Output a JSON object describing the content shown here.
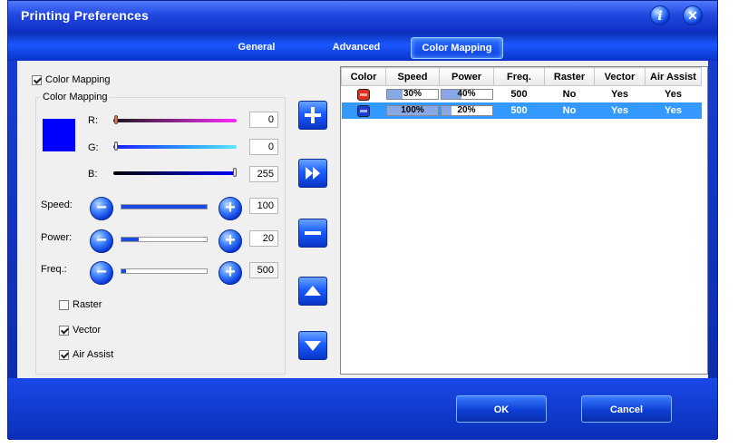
{
  "window": {
    "title": "Printing Preferences"
  },
  "header": {
    "info_icon": "info-icon",
    "close_icon": "close-icon"
  },
  "tabs": [
    {
      "label": "General",
      "active": false
    },
    {
      "label": "Advanced",
      "active": false
    },
    {
      "label": "Color Mapping",
      "active": true
    }
  ],
  "left": {
    "color_mapping_checkbox": {
      "label": "Color Mapping",
      "checked": true
    },
    "group_title": "Color Mapping",
    "swatch_color": "#0000ff",
    "rgb": [
      {
        "label": "R:",
        "value": "0",
        "level": 0
      },
      {
        "label": "G:",
        "value": "0",
        "level": 0
      },
      {
        "label": "B:",
        "value": "255",
        "level": 1
      }
    ],
    "params": [
      {
        "label": "Speed:",
        "value": "100",
        "level": 1.0,
        "readonly": false
      },
      {
        "label": "Power:",
        "value": "20",
        "level": 0.2,
        "readonly": false
      },
      {
        "label": "Freq.:",
        "value": "500",
        "level": 0.05,
        "readonly": true
      }
    ],
    "options": [
      {
        "label": "Raster",
        "checked": false
      },
      {
        "label": "Vector",
        "checked": true
      },
      {
        "label": "Air Assist",
        "checked": true
      }
    ]
  },
  "middle_buttons": [
    "add-icon",
    "fast-forward-icon",
    "remove-icon",
    "move-up-icon",
    "move-down-icon"
  ],
  "table": {
    "columns": [
      "Color",
      "Speed",
      "Power",
      "Freq.",
      "Raster",
      "Vector",
      "Air Assist"
    ],
    "rows": [
      {
        "color": "#e0301e",
        "speed": "30%",
        "speed_level": 0.3,
        "power": "40%",
        "power_level": 0.4,
        "freq": "500",
        "raster": "No",
        "vector": "Yes",
        "air_assist": "Yes",
        "selected": false
      },
      {
        "color": "#1a3fd8",
        "speed": "100%",
        "speed_level": 1.0,
        "power": "20%",
        "power_level": 0.2,
        "freq": "500",
        "raster": "No",
        "vector": "Yes",
        "air_assist": "Yes",
        "selected": true
      }
    ]
  },
  "footer": {
    "ok_label": "OK",
    "cancel_label": "Cancel"
  }
}
